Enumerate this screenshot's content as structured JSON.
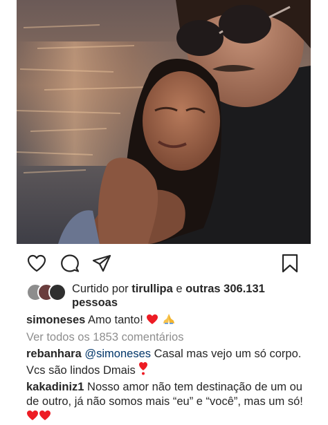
{
  "post": {
    "photo_icon": "couple-selfie-photo"
  },
  "actions": {
    "like_icon": "heart-outline-icon",
    "comment_icon": "comment-bubble-icon",
    "share_icon": "paper-plane-icon",
    "save_icon": "bookmark-icon"
  },
  "likes": {
    "prefix": "Curtido por ",
    "user": "tirullipa",
    "connector": " e ",
    "others": "outras 306.131",
    "suffix": "pessoas"
  },
  "caption": {
    "username": "simoneses",
    "text": "Amo tanto!"
  },
  "view_all_comments": "Ver todos os 1853 comentários",
  "comments": [
    {
      "username": "rebanhara",
      "mention": "@simoneses",
      "text": " Casal mas vejo um só corpo. Vcs são lindos Dmais"
    },
    {
      "username": "kakadiniz1",
      "text": " Nosso amor não tem destinação de um ou de outro, já não somos mais “eu” e “você”, mas um só!"
    }
  ],
  "colors": {
    "text": "#262626",
    "muted": "#8e8e8e",
    "mention": "#003569",
    "heart": "#ed4956"
  }
}
